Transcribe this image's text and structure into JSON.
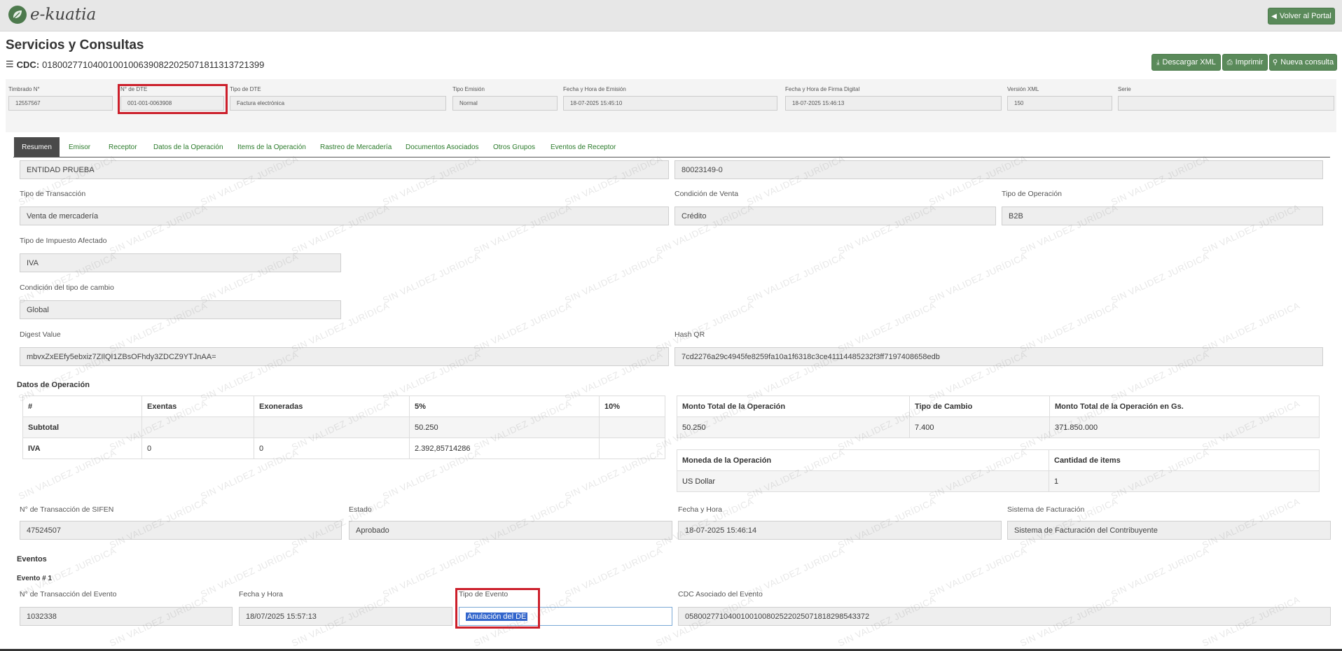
{
  "app": {
    "brand": "e-kuatia",
    "back_label": "Volver al Portal"
  },
  "page": {
    "title": "Servicios y Consultas",
    "cdc_label": "CDC:",
    "cdc_value": "01800277104001001006390822025071811313721399"
  },
  "actions": {
    "download": "Descargar XML",
    "print": "Imprimir",
    "new_query": "Nueva consulta"
  },
  "header": {
    "timbrado": {
      "label": "Timbrado N°",
      "value": "12557567"
    },
    "nro_dte": {
      "label": "N° de DTE",
      "value": "001-001-0063908"
    },
    "tipo_dte": {
      "label": "Tipo de DTE",
      "value": "Factura electrónica"
    },
    "tipo_emision": {
      "label": "Tipo Emisión",
      "value": "Normal"
    },
    "fecha_emision": {
      "label": "Fecha y Hora de Emisión",
      "value": "18-07-2025 15:45:10"
    },
    "fecha_firma": {
      "label": "Fecha y Hora de Firma Digital",
      "value": "18-07-2025 15:46:13"
    },
    "version_xml": {
      "label": "Versión XML",
      "value": "150"
    },
    "serie": {
      "label": "Serie",
      "value": ""
    }
  },
  "tabs": [
    "Resumen",
    "Emisor",
    "Receptor",
    "Datos de la Operación",
    "Items de la Operación",
    "Rastreo de Mercadería",
    "Documentos Asociados",
    "Otros Grupos",
    "Eventos de Receptor"
  ],
  "summary": {
    "entidad": "ENTIDAD PRUEBA",
    "ruc": "80023149-0",
    "tipo_transaccion": {
      "label": "Tipo de Transacción",
      "value": "Venta de mercadería"
    },
    "condicion_venta": {
      "label": "Condición de Venta",
      "value": "Crédito"
    },
    "tipo_operacion": {
      "label": "Tipo de Operación",
      "value": "B2B"
    },
    "tipo_impuesto": {
      "label": "Tipo de Impuesto Afectado",
      "value": "IVA"
    },
    "condicion_cambio": {
      "label": "Condición del tipo de cambio",
      "value": "Global"
    },
    "digest": {
      "label": "Digest Value",
      "value": "mbvxZxEEfy5ebxiz7ZIlQI1ZBsOFhdy3ZDCZ9YTJnAA="
    },
    "hash_qr": {
      "label": "Hash QR",
      "value": "7cd2276a29c4945fe8259fa10a1f6318c3ce41114485232f3ff7197408658edb"
    }
  },
  "operacion": {
    "title": "Datos de Operación",
    "table1": {
      "headers": [
        "#",
        "Exentas",
        "Exoneradas",
        "5%",
        "10%"
      ],
      "rows": [
        [
          "Subtotal",
          "",
          "",
          "50.250",
          ""
        ],
        [
          "IVA",
          "0",
          "0",
          "2.392,85714286",
          ""
        ]
      ]
    },
    "table2": {
      "headers": [
        "Monto Total de la Operación",
        "Tipo de Cambio",
        "Monto Total de la Operación en Gs."
      ],
      "row": [
        "50.250",
        "7.400",
        "371.850.000"
      ]
    },
    "table3": {
      "headers": [
        "Moneda de la Operación",
        "Cantidad de items"
      ],
      "row": [
        "US Dollar",
        "1"
      ]
    }
  },
  "transaccion": {
    "nro": {
      "label": "N° de Transacción de SIFEN",
      "value": "47524507"
    },
    "estado": {
      "label": "Estado",
      "value": "Aprobado"
    },
    "fecha": {
      "label": "Fecha y Hora",
      "value": "18-07-2025 15:46:14"
    },
    "sistema": {
      "label": "Sistema de Facturación",
      "value": "Sistema de Facturación del Contribuyente"
    }
  },
  "eventos": {
    "title": "Eventos",
    "item_title": "Evento # 1",
    "nro": {
      "label": "N° de Transacción del Evento",
      "value": "1032338"
    },
    "fecha": {
      "label": "Fecha y Hora",
      "value": "18/07/2025 15:57:13"
    },
    "tipo": {
      "label": "Tipo de Evento",
      "value": "Anulación del DE"
    },
    "cdc": {
      "label": "CDC Asociado del Evento",
      "value": "05800277104001001008025220250718182985433​72"
    }
  },
  "watermark_text": "SIN VALIDEZ JURÍDICA"
}
